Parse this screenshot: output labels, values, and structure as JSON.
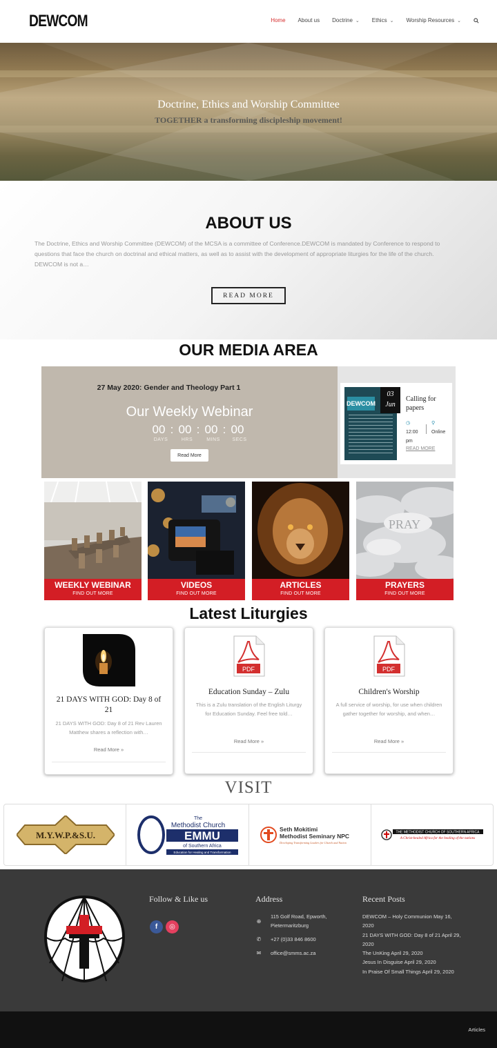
{
  "header": {
    "logo_text": "DEWCOM",
    "nav": [
      {
        "label": "Home",
        "active": true,
        "dropdown": false
      },
      {
        "label": "About us",
        "active": false,
        "dropdown": false
      },
      {
        "label": "Doctrine",
        "active": false,
        "dropdown": true
      },
      {
        "label": "Ethics",
        "active": false,
        "dropdown": true
      },
      {
        "label": "Worship Resources",
        "active": false,
        "dropdown": true
      }
    ],
    "search_icon": "search-icon"
  },
  "hero": {
    "title": "Doctrine, Ethics and Worship Committee",
    "subtitle": "TOGETHER a transforming discipleship movement!"
  },
  "about": {
    "title": "ABOUT US",
    "text": "The Doctrine, Ethics and Worship Committee (DEWCOM) of the MCSA is a committee of Conference.DEWCOM is mandated by Conference to respond to questions that face the church on doctrinal and ethical matters, as well as to assist with the development of appropriate liturgies for the life of the church. DEWCOM is not a…",
    "button": "READ MORE"
  },
  "media": {
    "title": "OUR MEDIA AREA",
    "webinar": {
      "date_title": "27 May 2020: Gender and Theology Part 1",
      "heading": "Our Weekly Webinar",
      "countdown": {
        "days": "00",
        "hrs": "00",
        "mins": "00",
        "secs": "00",
        "sep": ":"
      },
      "labels": {
        "days": "DAYS",
        "hrs": "HRS",
        "mins": "MINS",
        "secs": "SECS"
      },
      "button": "Read More"
    },
    "event": {
      "poster_text": "DEWCOM",
      "day": "03",
      "month": "Jun",
      "title": "Calling for papers",
      "time": "12:00 pm",
      "place": "Online",
      "more": "READ MORE"
    },
    "tiles": [
      {
        "title": "WEEKLY WEBINAR",
        "sub": "FIND OUT MORE"
      },
      {
        "title": "VIDEOS",
        "sub": "FIND OUT MORE"
      },
      {
        "title": "ARTICLES",
        "sub": "FIND OUT MORE"
      },
      {
        "title": "PRAYERS",
        "sub": "FIND OUT MORE",
        "overlay": "PRAY"
      }
    ]
  },
  "liturgies": {
    "title": "Latest Liturgies",
    "cards": [
      {
        "title": "21 DAYS WITH GOD: Day 8 of 21",
        "desc": "21 DAYS WITH GOD: Day 8 of 21 Rev Lauren Matthew shares a reflection with…",
        "more": "Read More »"
      },
      {
        "title": "Education Sunday – Zulu",
        "desc": "This is a Zulu translation of the English Liturgy for Education Sunday. Feel free told…",
        "more": "Read More »",
        "icon_label": "PDF"
      },
      {
        "title": "Children's Worship",
        "desc": "A full service of worship, for use when children gather together for worship, and when…",
        "more": "Read More »",
        "icon_label": "PDF"
      }
    ]
  },
  "visit": {
    "title": "VISIT",
    "logos": [
      {
        "text": "M.Y.W.P.&S.U."
      },
      {
        "small": "The",
        "line1": "Methodist Church",
        "big": "EMMU",
        "line2": "of Southern Africa",
        "line3": "Education for Healing and Transformation"
      },
      {
        "line1": "Seth Mokitimi",
        "line2": "Methodist Seminary NPC",
        "line3": "Developing Transforming Leaders for Church and Nation"
      },
      {
        "line1": "THE METHODIST CHURCH OF SOUTHERN AFRICA",
        "line2": "A Christ-healed Africa for the healing of the nations"
      }
    ]
  },
  "footer": {
    "follow_title": "Follow & Like us",
    "social": [
      {
        "label": "f",
        "color": "#3b5998"
      },
      {
        "label": "◎",
        "color": "#e4405f"
      }
    ],
    "address_title": "Address",
    "address": "115 Golf Road, Epworth, Pietermaritzburg",
    "phone": "+27 (0)33 846 8600",
    "email": "office@smms.ac.za",
    "posts_title": "Recent Posts",
    "posts": [
      "DEWCOM – Holy Communion May 16, 2020",
      "21 DAYS WITH GOD: Day 8 of 21 April 29, 2020",
      "The UnKing April 29, 2020",
      "Jesus In Disguise April 29, 2020",
      "In Praise Of Small Things April 29, 2020"
    ]
  },
  "bottom": {
    "articles": "Articles"
  },
  "colors": {
    "accent": "#d31e25",
    "nav_active": "#d62d2d",
    "footer_bg": "#3a3a3a"
  }
}
